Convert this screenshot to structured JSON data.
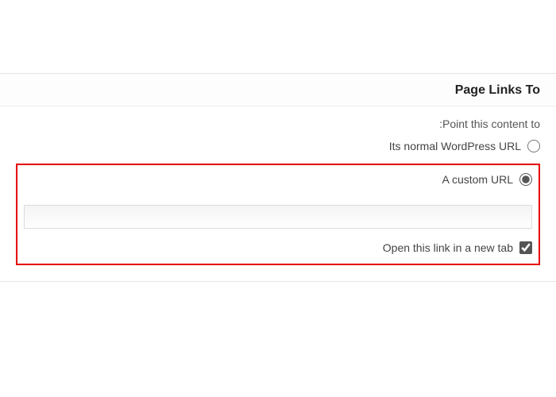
{
  "metabox": {
    "title": "Page Links To",
    "point_label": ":Point this content to",
    "options": {
      "normal": {
        "label": "Its normal WordPress URL",
        "checked": false
      },
      "custom": {
        "label": "A custom URL",
        "checked": true
      }
    },
    "url_input": {
      "value": "",
      "placeholder": ""
    },
    "new_tab": {
      "label": "Open this link in a new tab",
      "checked": true
    }
  }
}
